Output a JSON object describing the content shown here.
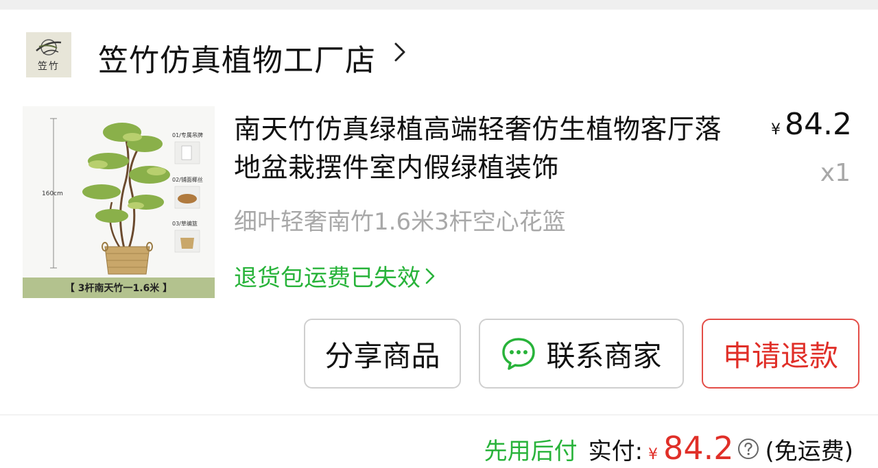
{
  "store": {
    "logo_text": "笠竹",
    "name": "笠竹仿真植物工厂店"
  },
  "product": {
    "thumbnail": {
      "height_label": "160cm",
      "steps": [
        "01/专属吊牌",
        "02/铺面椰丝",
        "03/草编篮"
      ],
      "band_text": "【  3杆南天竹一1.6米  】"
    },
    "title": "南天竹仿真绿植高端轻奢仿生植物客厅落地盆栽摆件室内假绿植装饰",
    "spec": "细叶轻奢南竹1.6米3杆空心花篮",
    "return_notice": "退货包运费已失效",
    "currency": "¥",
    "price": "84.2",
    "quantity": "x1"
  },
  "actions": {
    "share_label": "分享商品",
    "contact_label": "联系商家",
    "refund_label": "申请退款"
  },
  "summary": {
    "pay_later": "先用后付",
    "paid_label": "实付:",
    "currency": "¥",
    "amount": "84.2",
    "shipping": "(免运费)"
  },
  "colors": {
    "accent_green": "#28b33a",
    "refund_red": "#e02f28",
    "muted_gray": "#a8a8a8"
  },
  "icons": [
    "chevron-right-icon",
    "chat-bubble-icon",
    "question-circle-icon"
  ]
}
